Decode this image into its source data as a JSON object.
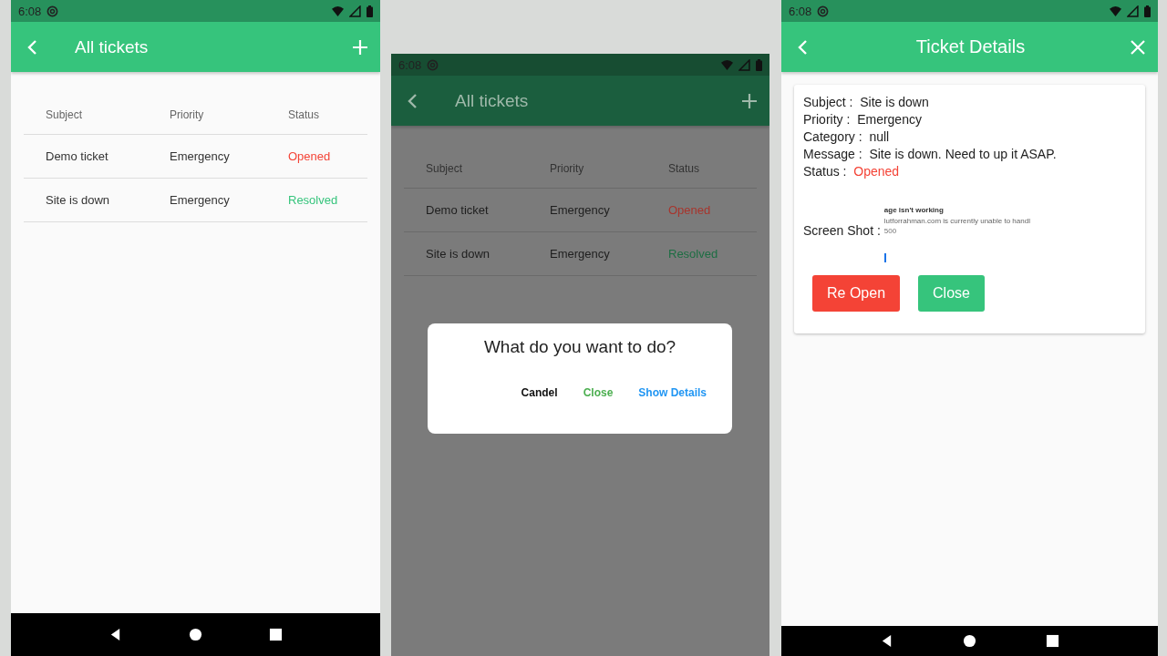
{
  "list_screen": {
    "status_bar": {
      "time": "6:08"
    },
    "app_bar": {
      "title": "All tickets"
    },
    "table": {
      "columns": [
        "Subject",
        "Priority",
        "Status"
      ],
      "rows": [
        {
          "subject": "Demo ticket",
          "priority": "Emergency",
          "status": "Opened",
          "color": "#f44336"
        },
        {
          "subject": "Site is down",
          "priority": "Emergency",
          "status": "Resolved",
          "color": "#36c47c"
        }
      ]
    }
  },
  "dialog_screen": {
    "status_bar": {
      "time": "6:08"
    },
    "app_bar": {
      "title": "All tickets"
    },
    "table": {
      "columns": [
        "Subject",
        "Priority",
        "Status"
      ],
      "rows": [
        {
          "subject": "Demo ticket",
          "priority": "Emergency",
          "status": "Opened",
          "color": "#a8342c"
        },
        {
          "subject": "Site is down",
          "priority": "Emergency",
          "status": "Resolved",
          "color": "#1d6e43"
        }
      ]
    },
    "dialog": {
      "title": "What do you want to do?",
      "buttons": [
        {
          "label": "Candel",
          "kind": "neutral"
        },
        {
          "label": "Close",
          "kind": "confirm"
        },
        {
          "label": "Show Details",
          "kind": "info"
        }
      ]
    }
  },
  "details_screen": {
    "status_bar": {
      "time": "6:08"
    },
    "app_bar": {
      "title": "Ticket Details"
    },
    "fields": [
      {
        "label": "Subject :",
        "value": "Site is down"
      },
      {
        "label": "Priority :",
        "value": "Emergency"
      },
      {
        "label": "Category :",
        "value": "null"
      },
      {
        "label": "Message :",
        "value": "Site is down. Need to up it ASAP."
      },
      {
        "label": "Status :",
        "value": "Opened",
        "color": "#f44336"
      }
    ],
    "screenshot": {
      "label": "Screen Shot :",
      "heading": "age isn't working",
      "line": "lutforrahman.com is currently unable to handl",
      "code": "500"
    },
    "buttons": [
      {
        "label": "Re Open",
        "kind": "danger"
      },
      {
        "label": "Close",
        "kind": "success"
      }
    ]
  }
}
